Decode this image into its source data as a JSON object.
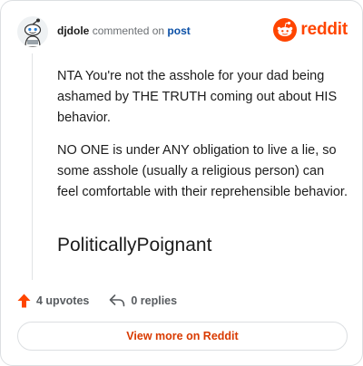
{
  "header": {
    "username": "djdole",
    "action_text": "commented on",
    "post_link": "post",
    "brand_name": "reddit"
  },
  "comment": {
    "paragraphs": [
      "NTA You're not the asshole for your dad being ashamed by THE TRUTH coming out about HIS behavior.",
      "NO ONE is under ANY obligation to live a lie, so some asshole (usually a religious person) can feel comfortable with their reprehensible behavior."
    ],
    "signature": "PoliticallyPoignant"
  },
  "actions": {
    "upvotes_label": "4 upvotes",
    "replies_label": "0 replies"
  },
  "footer": {
    "view_more_label": "View more on Reddit"
  },
  "colors": {
    "brand": "#ff4500",
    "link": "#0a4fa6",
    "cta_text": "#d93a00",
    "muted": "#6b6f73"
  },
  "icons": {
    "avatar": "snoo-avatar-icon",
    "brand": "reddit-logo-icon",
    "upvote": "upvote-arrow-icon",
    "reply": "reply-arrow-icon"
  }
}
